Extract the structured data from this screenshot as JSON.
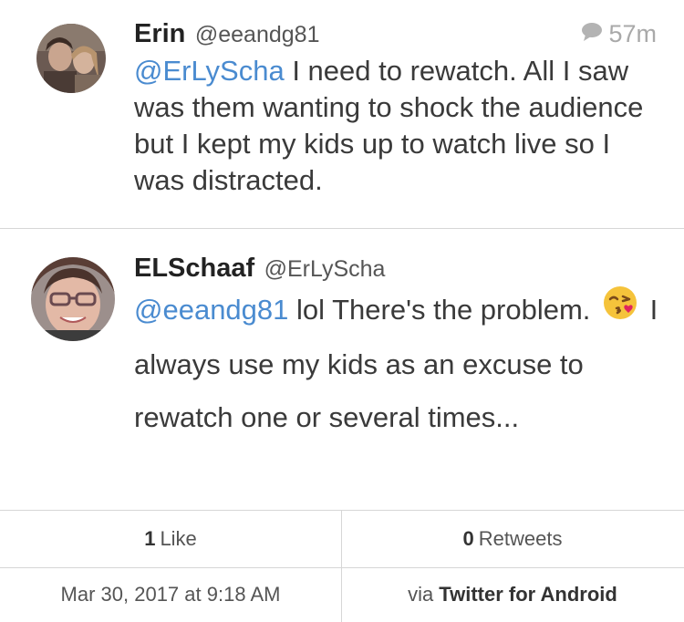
{
  "tweets": [
    {
      "display_name": "Erin",
      "handle": "@eeandg81",
      "reply_time": "57m",
      "mention": "@ErLyScha",
      "text": " I need to rewatch. All I saw was them wanting to shock the audience but I kept my kids up to watch live so I was distracted."
    },
    {
      "display_name": "ELSchaaf",
      "handle": "@ErLyScha",
      "mention": "@eeandg81",
      "text_before_emoji": " lol There's the problem.",
      "emoji": "face-blowing-a-kiss-emoji",
      "text_after_emoji": "I always use my kids as an excuse to rewatch one or several times..."
    }
  ],
  "stats": {
    "likes_count": "1",
    "likes_label": "Like",
    "retweets_count": "0",
    "retweets_label": "Retweets"
  },
  "footer": {
    "timestamp": "Mar 30, 2017 at 9:18 AM",
    "via_label": "via",
    "client": "Twitter for Android"
  },
  "colors": {
    "mention": "#4a8bd0",
    "meta_gray": "#a9a9a9",
    "divider": "#d6d6d6"
  }
}
